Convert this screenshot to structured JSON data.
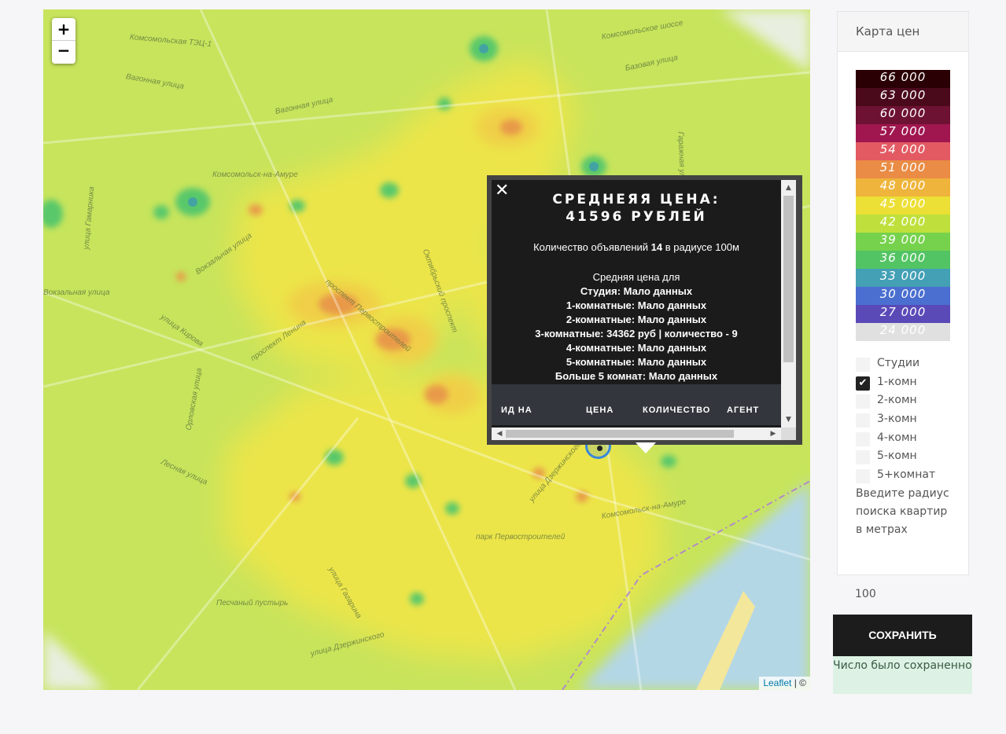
{
  "map": {
    "zoom_in": "+",
    "zoom_out": "−",
    "attribution_link": "Leaflet",
    "attribution_rest": " | ©",
    "streets": [
      "Комсомольская ТЭЦ-1",
      "Вагонная улица",
      "Вагонная улица",
      "Комсомольское шоссе",
      "Базовая улица",
      "Комсомольск-на-Амуре",
      "Вокзальная улица",
      "Вокзальная улица",
      "проспект Ленина",
      "проспект Первостроителей",
      "Октябрьский проспект",
      "улица Кирова",
      "улица Гамарника",
      "Орловская улица",
      "Лесная улица",
      "улица Дзержинского",
      "Комсомольск-на-Амуре",
      "парк Первостроителей",
      "Песчаный пустырь",
      "улица Гагарина",
      "улица Дзержинского",
      "Гаражная улица"
    ]
  },
  "popup": {
    "close": "✕",
    "title_line1": "СРЕДНЕЯЯ ЦЕНА:",
    "title_line2": "41596 РУБЛЕЙ",
    "count_prefix": "Количество объявлений ",
    "count_value": "14",
    "count_suffix": " в радиусе 100м",
    "avg_header": "Средняя цена для",
    "stats": [
      "Студия: Мало данных",
      "1-комнатные: Мало данных",
      "2-комнатные: Мало данных",
      "3-комнатные: 34362 руб | количество - 9",
      "4-комнатные: Мало данных",
      "5-комнатные: Мало данных",
      "Больше 5 комнат: Мало данных"
    ],
    "table_headers": [
      "ИД НА АВИТО",
      "ЦЕНА ЗА",
      "КОЛИЧЕСТВО КОМНАТ",
      "АГЕНТ ЛИ?"
    ]
  },
  "sidebar": {
    "title": "Карта цен",
    "legend": [
      {
        "label": "66 000",
        "color": "#2a0005"
      },
      {
        "label": "63 000",
        "color": "#4b0a1c"
      },
      {
        "label": "60 000",
        "color": "#6d1233"
      },
      {
        "label": "57 000",
        "color": "#a0174f"
      },
      {
        "label": "54 000",
        "color": "#e35a63"
      },
      {
        "label": "51 000",
        "color": "#ea8c45"
      },
      {
        "label": "48 000",
        "color": "#efb43c"
      },
      {
        "label": "45 000",
        "color": "#ecdf35"
      },
      {
        "label": "42 000",
        "color": "#bfe03c"
      },
      {
        "label": "39 000",
        "color": "#76d24c"
      },
      {
        "label": "36 000",
        "color": "#53c463"
      },
      {
        "label": "33 000",
        "color": "#43a0b5"
      },
      {
        "label": "30 000",
        "color": "#4a6fd0"
      },
      {
        "label": "27 000",
        "color": "#5a4ab8"
      },
      {
        "label": "24 000",
        "color": "#e0e0e0"
      }
    ],
    "filters": [
      {
        "label": "Студии",
        "checked": false
      },
      {
        "label": "1-комн",
        "checked": true
      },
      {
        "label": "2-комн",
        "checked": false
      },
      {
        "label": "3-комн",
        "checked": false
      },
      {
        "label": "4-комн",
        "checked": false
      },
      {
        "label": "5-комн",
        "checked": false
      },
      {
        "label": "5+комнат",
        "checked": false
      }
    ],
    "radius_prompt": "Введите радиус поиска квартир в метрах",
    "radius_value": "100",
    "save_label": "СОХРАНИТЬ",
    "saved_message": "Число было сохраненно"
  }
}
